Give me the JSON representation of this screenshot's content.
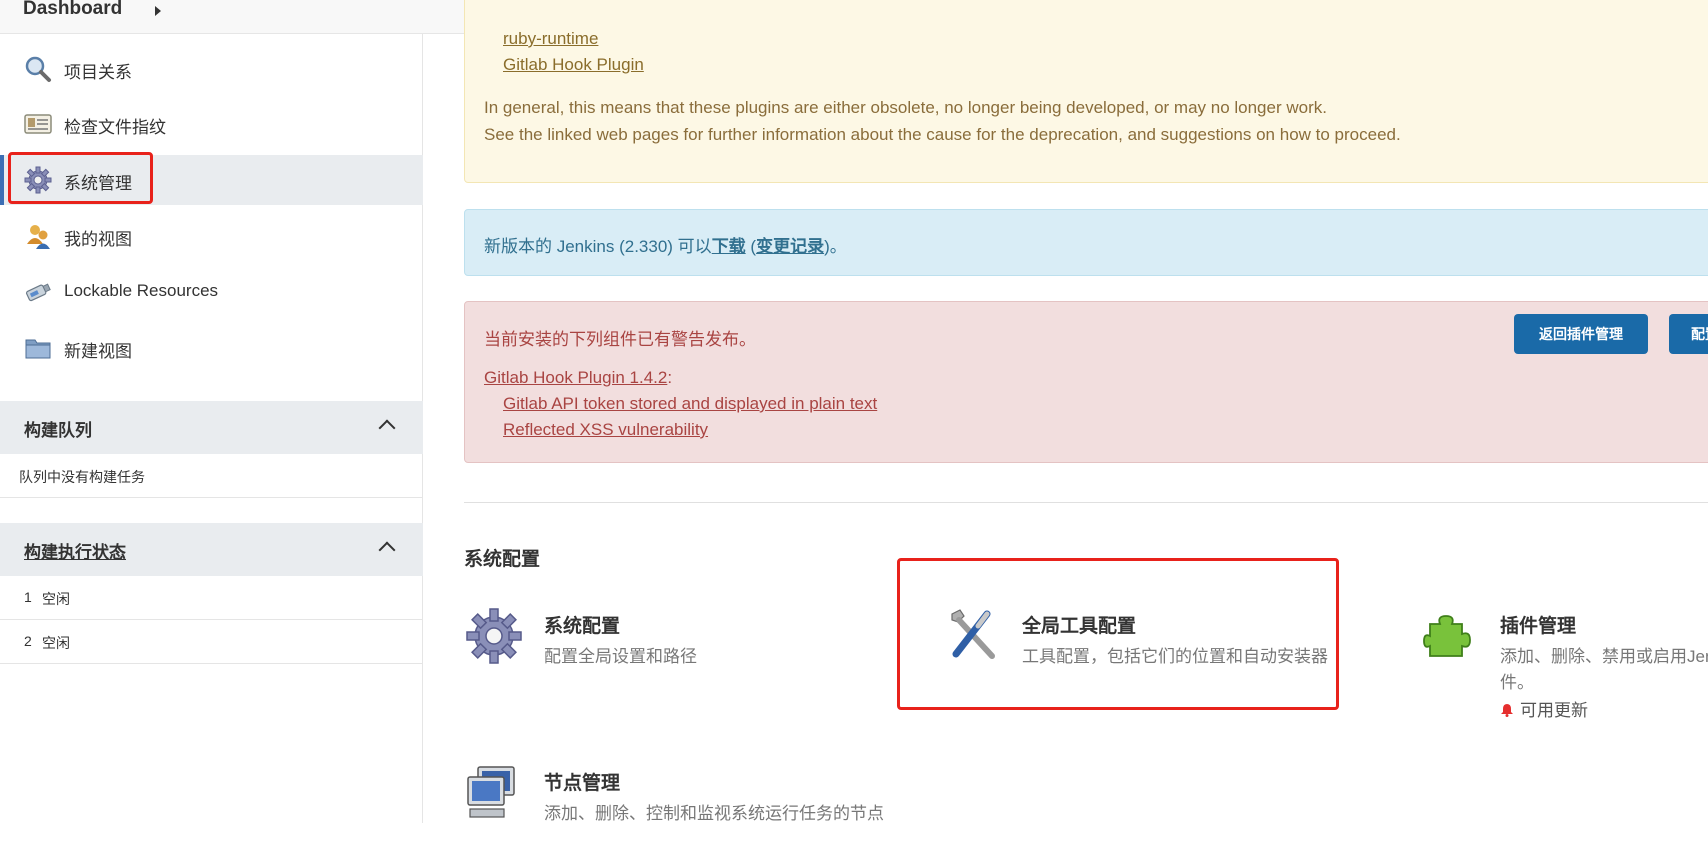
{
  "breadcrumb": {
    "label": "Dashboard"
  },
  "sidebar": {
    "items": [
      {
        "label": "项目关系",
        "icon": "search-icon"
      },
      {
        "label": "检查文件指纹",
        "icon": "fingerprint-icon"
      },
      {
        "label": "系统管理",
        "icon": "gear-icon"
      },
      {
        "label": "我的视图",
        "icon": "users-icon"
      },
      {
        "label": "Lockable Resources",
        "icon": "usb-drive-icon"
      },
      {
        "label": "新建视图",
        "icon": "folder-icon"
      }
    ],
    "build_queue": {
      "title": "构建队列",
      "empty_text": "队列中没有构建任务"
    },
    "executor_status": {
      "title": "构建执行状态",
      "executors": [
        {
          "num": "1",
          "status": "空闲"
        },
        {
          "num": "2",
          "status": "空闲"
        }
      ]
    }
  },
  "deprecation": {
    "links": [
      "ruby-runtime",
      "Gitlab Hook Plugin"
    ],
    "line1": "In general, this means that these plugins are either obsolete, no longer being developed, or may no longer work.",
    "line2": "See the linked web pages for further information about the cause for the deprecation, and suggestions on how to proceed."
  },
  "update_notice": {
    "prefix": "新版本的 Jenkins (2.330) 可以",
    "download": "下载",
    "open_paren": " (",
    "changelog": "变更记录",
    "suffix": ")。"
  },
  "warning": {
    "title": "当前安装的下列组件已有警告发布。",
    "plugin": "Gitlab Hook Plugin 1.4.2",
    "colon": ":",
    "issues": [
      "Gitlab API token stored and displayed in plain text",
      "Reflected XSS vulnerability"
    ],
    "btn_back": "返回插件管理",
    "btn_config": "配置"
  },
  "system_config": {
    "section_title": "系统配置",
    "items": [
      {
        "title": "系统配置",
        "desc": "配置全局设置和路径",
        "icon": "gear-icon"
      },
      {
        "title": "全局工具配置",
        "desc": "工具配置，包括它们的位置和自动安装器",
        "icon": "tools-icon"
      },
      {
        "title": "插件管理",
        "desc": "添加、删除、禁用或启用Jenkins插",
        "desc2": "件。",
        "update": "可用更新",
        "icon": "puzzle-icon"
      },
      {
        "title": "节点管理",
        "desc": "添加、删除、控制和监视系统运行任务的节点",
        "icon": "computer-icon"
      }
    ]
  },
  "colors": {
    "accent": "#3c6eb4",
    "highlight_box": "#e8221b",
    "button": "#1a6aa8"
  }
}
